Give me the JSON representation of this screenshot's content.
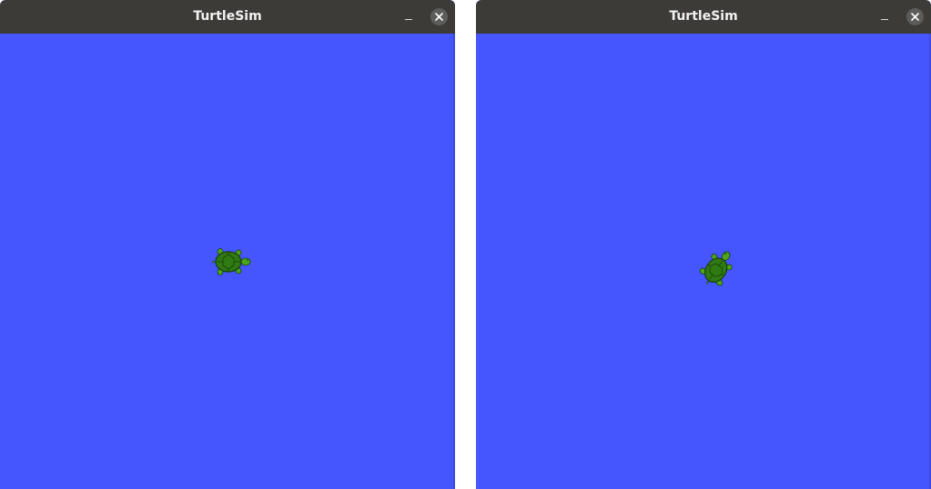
{
  "windows": [
    {
      "title": "TurtleSim",
      "minimize_label": "–",
      "canvas_color": "#4556ff",
      "turtle_icon": "turtle-icon",
      "turtle_heading": "east"
    },
    {
      "title": "TurtleSim",
      "minimize_label": "–",
      "canvas_color": "#4556ff",
      "turtle_icon": "turtle-icon",
      "turtle_heading": "north-east"
    }
  ],
  "colors": {
    "titlebar": "#3c3b37",
    "title_text": "#f2f2f2",
    "close_button": "#5c5c5a",
    "turtle_shell": "#2f7a12",
    "turtle_skin": "#4aa51c"
  }
}
